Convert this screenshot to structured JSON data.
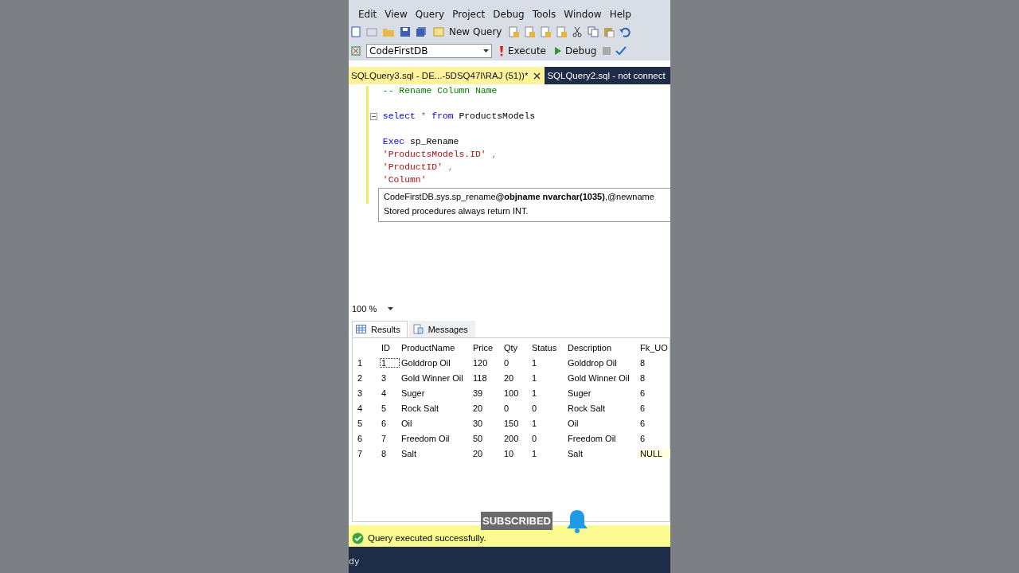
{
  "menu": [
    "Edit",
    "View",
    "Query",
    "Project",
    "Debug",
    "Tools",
    "Window",
    "Help"
  ],
  "toolbar": {
    "new_query": "New Query",
    "database": "CodeFirstDB",
    "execute": "Execute",
    "debug": "Debug"
  },
  "tabs": [
    {
      "label": "SQLQuery3.sql - DE...-5DSQ47I\\RAJ (51))*",
      "selected": true,
      "closable": true
    },
    {
      "label": "SQLQuery2.sql - not connect",
      "selected": false,
      "closable": false
    }
  ],
  "editor": {
    "lines": [
      {
        "tokens": [
          {
            "kind": "comment",
            "text": "-- Rename Column Name"
          }
        ]
      },
      {
        "kind": "blank"
      },
      {
        "collapsible": true,
        "tokens": [
          {
            "kind": "keyword",
            "text": "select"
          },
          {
            "kind": "operator",
            "text": "*"
          },
          {
            "kind": "keyword",
            "text": "from"
          },
          {
            "kind": "plain",
            "text": "ProductsModels"
          }
        ]
      },
      {
        "kind": "blank"
      },
      {
        "tokens": [
          {
            "kind": "keyword",
            "text": "Exec"
          },
          {
            "kind": "plain",
            "text": "sp_Rename"
          }
        ]
      },
      {
        "tokens": [
          {
            "kind": "string",
            "text": "'ProductsModels.ID'"
          },
          {
            "kind": "operator",
            "text": ","
          }
        ]
      },
      {
        "tokens": [
          {
            "kind": "string",
            "text": "'ProductID'"
          },
          {
            "kind": "operator",
            "text": ","
          }
        ]
      },
      {
        "tokens": [
          {
            "kind": "string",
            "text": "'Column'"
          }
        ]
      }
    ],
    "tooltip": [
      "CodeFirstDB.sys.sp_rename**@objname nvarchar(1035)**,@newname",
      "Stored procedures always return INT."
    ]
  },
  "zoom": "100 %",
  "result_tabs": [
    {
      "label": "Results",
      "selected": true
    },
    {
      "label": "Messages",
      "selected": false
    }
  ],
  "grid": {
    "columns": [
      "ID",
      "ProductName",
      "Price",
      "Qty",
      "Status",
      "Description",
      "Fk_UO"
    ],
    "rows": [
      {
        "number": "1",
        "focused": true,
        "fk_null": false,
        "cells": [
          "1",
          "Golddrop Oil",
          "120",
          "0",
          "1",
          "Golddrop Oil",
          "8"
        ]
      },
      {
        "number": "2",
        "focused": false,
        "fk_null": false,
        "cells": [
          "3",
          "Gold Winner Oil",
          "118",
          "20",
          "1",
          "Gold Winner Oil",
          "8"
        ]
      },
      {
        "number": "3",
        "focused": false,
        "fk_null": false,
        "cells": [
          "4",
          "Suger",
          "39",
          "100",
          "1",
          "Suger",
          "6"
        ]
      },
      {
        "number": "4",
        "focused": false,
        "fk_null": false,
        "cells": [
          "5",
          "Rock Salt",
          "20",
          "0",
          "0",
          "Rock Salt",
          "6"
        ]
      },
      {
        "number": "5",
        "focused": false,
        "fk_null": false,
        "cells": [
          "6",
          "Oil",
          "30",
          "150",
          "1",
          "Oil",
          "6"
        ]
      },
      {
        "number": "6",
        "focused": false,
        "fk_null": false,
        "cells": [
          "7",
          "Freedom Oil",
          "50",
          "200",
          "0",
          "Freedom Oil",
          "6"
        ]
      },
      {
        "number": "7",
        "focused": false,
        "fk_null": true,
        "cells": [
          "8",
          "Salt",
          "20",
          "10",
          "1",
          "Salt",
          "NULL"
        ]
      }
    ]
  },
  "status": "Query executed successfully.",
  "overlay": {
    "button": "SUBSCRIBED"
  },
  "bottom_bar": "dy"
}
